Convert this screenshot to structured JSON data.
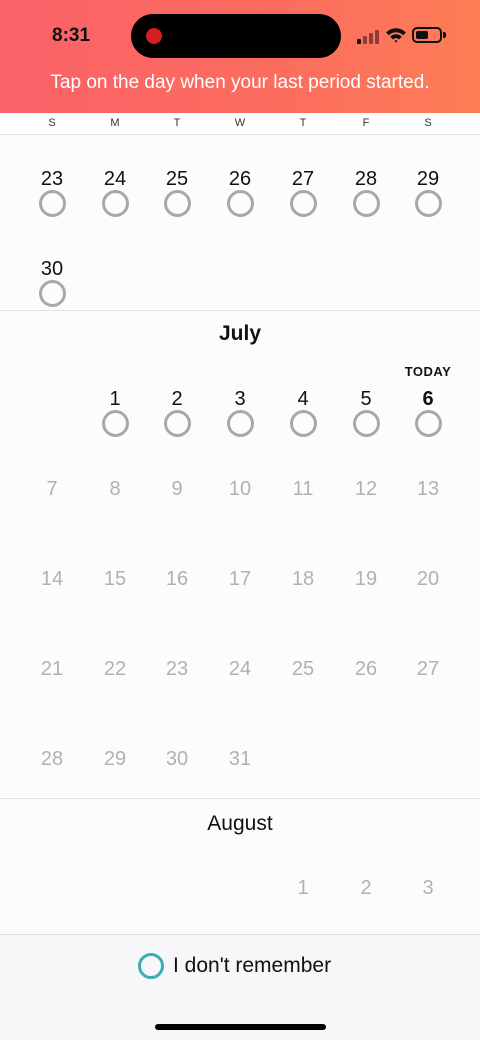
{
  "status_bar": {
    "time": "8:31",
    "signal_bars_filled": 1,
    "signal_bars_total": 4
  },
  "header": {
    "instruction": "Tap on the day when your last period started."
  },
  "weekdays": [
    "S",
    "M",
    "T",
    "W",
    "T",
    "F",
    "S"
  ],
  "months": [
    {
      "name": "",
      "weeks": [
        [
          "23",
          "24",
          "25",
          "26",
          "27",
          "28",
          "29"
        ],
        [
          "30",
          "",
          "",
          "",
          "",
          "",
          ""
        ]
      ],
      "state": "active"
    },
    {
      "name": "July",
      "today_label": "TODAY",
      "today": "6",
      "weeks": [
        [
          "",
          "1",
          "2",
          "3",
          "4",
          "5",
          "6"
        ],
        [
          "7",
          "8",
          "9",
          "10",
          "11",
          "12",
          "13"
        ],
        [
          "14",
          "15",
          "16",
          "17",
          "18",
          "19",
          "20"
        ],
        [
          "21",
          "22",
          "23",
          "24",
          "25",
          "26",
          "27"
        ],
        [
          "28",
          "29",
          "30",
          "31",
          "",
          "",
          ""
        ]
      ],
      "active_through": "6"
    },
    {
      "name": "August",
      "weeks": [
        [
          "",
          "",
          "",
          "",
          "1",
          "2",
          "3"
        ]
      ],
      "state": "future"
    }
  ],
  "footer": {
    "dont_remember_label": "I don't remember"
  },
  "colors": {
    "header_start": "#fb6168",
    "header_end": "#fd7d55",
    "accent_ring": "#3aaeb6",
    "ring": "#a8a8ab",
    "future_day": "#b1b1b4"
  }
}
